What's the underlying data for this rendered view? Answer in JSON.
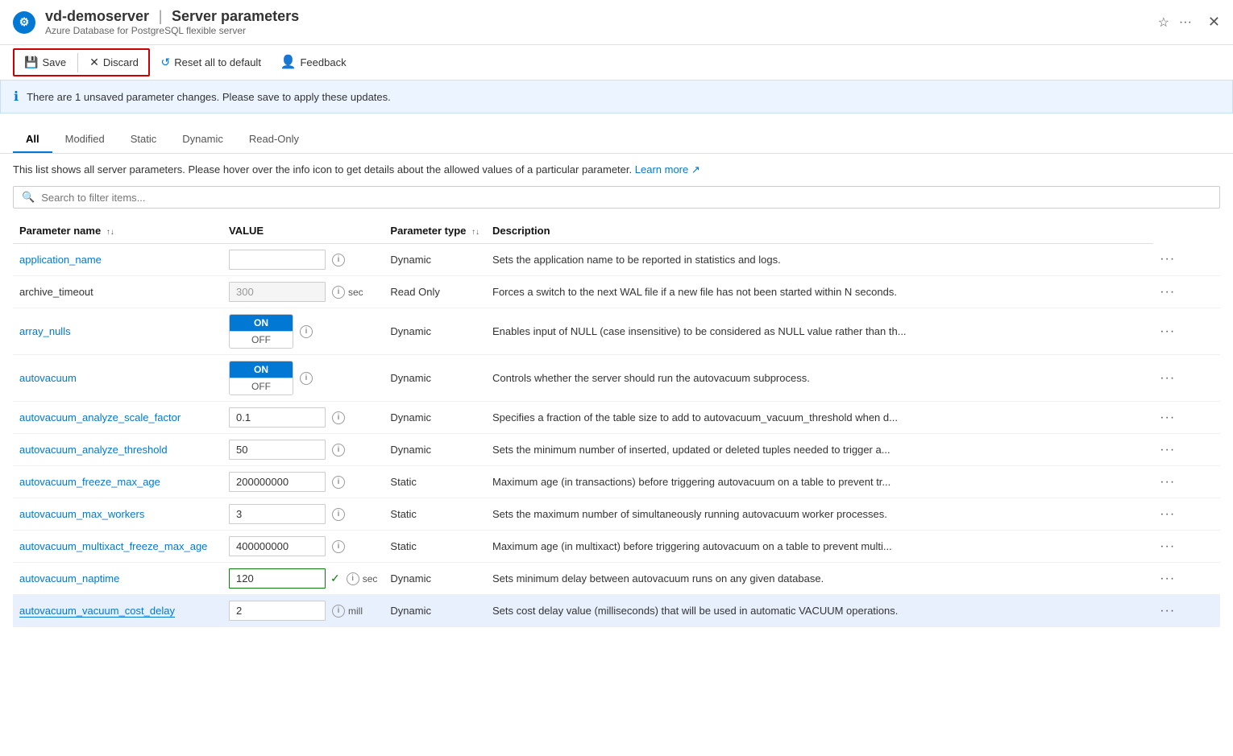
{
  "header": {
    "icon_text": "⚙",
    "server_name": "vd-demoserver",
    "separator": "|",
    "page_title": "Server parameters",
    "subtitle": "Azure Database for PostgreSQL flexible server",
    "star_icon": "☆",
    "ellipsis_icon": "···",
    "close_icon": "✕"
  },
  "toolbar": {
    "save_label": "Save",
    "discard_label": "Discard",
    "reset_label": "Reset all to default",
    "feedback_label": "Feedback",
    "save_icon": "💾",
    "discard_icon": "✕",
    "reset_icon": "↺",
    "feedback_icon": "👤"
  },
  "info_bar": {
    "icon": "ℹ",
    "message": "There are 1 unsaved parameter changes. Please save to apply these updates."
  },
  "tabs": [
    {
      "label": "All",
      "active": true
    },
    {
      "label": "Modified",
      "active": false
    },
    {
      "label": "Static",
      "active": false
    },
    {
      "label": "Dynamic",
      "active": false
    },
    {
      "label": "Read-Only",
      "active": false
    }
  ],
  "description": "This list shows all server parameters. Please hover over the info icon to get details about the allowed values of a particular parameter.",
  "learn_more": "Learn more",
  "search": {
    "placeholder": "Search to filter items..."
  },
  "table": {
    "headers": [
      {
        "label": "Parameter name",
        "sortable": true
      },
      {
        "label": "VALUE",
        "sortable": false
      },
      {
        "label": "Parameter type",
        "sortable": true
      },
      {
        "label": "Description",
        "sortable": false
      }
    ],
    "rows": [
      {
        "name": "application_name",
        "is_link": true,
        "value_type": "text",
        "value": "",
        "unit": "",
        "param_type": "Dynamic",
        "description": "Sets the application name to be reported in statistics and logs.",
        "highlighted": false
      },
      {
        "name": "archive_timeout",
        "is_link": false,
        "value_type": "text",
        "value": "300",
        "unit": "sec",
        "param_type": "Read Only",
        "description": "Forces a switch to the next WAL file if a new file has not been started within N seconds.",
        "disabled": true,
        "highlighted": false
      },
      {
        "name": "array_nulls",
        "is_link": true,
        "value_type": "toggle",
        "toggle_on": true,
        "unit": "",
        "param_type": "Dynamic",
        "description": "Enables input of NULL (case insensitive) to be considered as NULL value rather than th...",
        "highlighted": false
      },
      {
        "name": "autovacuum",
        "is_link": true,
        "value_type": "toggle",
        "toggle_on": true,
        "unit": "",
        "param_type": "Dynamic",
        "description": "Controls whether the server should run the autovacuum subprocess.",
        "highlighted": false
      },
      {
        "name": "autovacuum_analyze_scale_factor",
        "is_link": true,
        "value_type": "text",
        "value": "0.1",
        "unit": "",
        "param_type": "Dynamic",
        "description": "Specifies a fraction of the table size to add to autovacuum_vacuum_threshold when d...",
        "highlighted": false
      },
      {
        "name": "autovacuum_analyze_threshold",
        "is_link": true,
        "value_type": "text",
        "value": "50",
        "unit": "",
        "param_type": "Dynamic",
        "description": "Sets the minimum number of inserted, updated or deleted tuples needed to trigger a...",
        "highlighted": false
      },
      {
        "name": "autovacuum_freeze_max_age",
        "is_link": true,
        "value_type": "text",
        "value": "200000000",
        "unit": "",
        "param_type": "Static",
        "description": "Maximum age (in transactions) before triggering autovacuum on a table to prevent tr...",
        "highlighted": false
      },
      {
        "name": "autovacuum_max_workers",
        "is_link": true,
        "value_type": "text",
        "value": "3",
        "unit": "",
        "param_type": "Static",
        "description": "Sets the maximum number of simultaneously running autovacuum worker processes.",
        "highlighted": false
      },
      {
        "name": "autovacuum_multixact_freeze_max_age",
        "is_link": true,
        "value_type": "text",
        "value": "400000000",
        "unit": "",
        "param_type": "Static",
        "description": "Maximum age (in multixact) before triggering autovacuum on a table to prevent multi...",
        "highlighted": false
      },
      {
        "name": "autovacuum_naptime",
        "is_link": true,
        "value_type": "text",
        "value": "120",
        "unit": "sec",
        "param_type": "Dynamic",
        "description": "Sets minimum delay between autovacuum runs on any given database.",
        "modified": true,
        "highlighted": false
      },
      {
        "name": "autovacuum_vacuum_cost_delay",
        "is_link": true,
        "value_type": "text",
        "value": "2",
        "unit": "mill",
        "param_type": "Dynamic",
        "description": "Sets cost delay value (milliseconds) that will be used in automatic VACUUM operations.",
        "highlighted": true,
        "selected": true
      }
    ]
  }
}
